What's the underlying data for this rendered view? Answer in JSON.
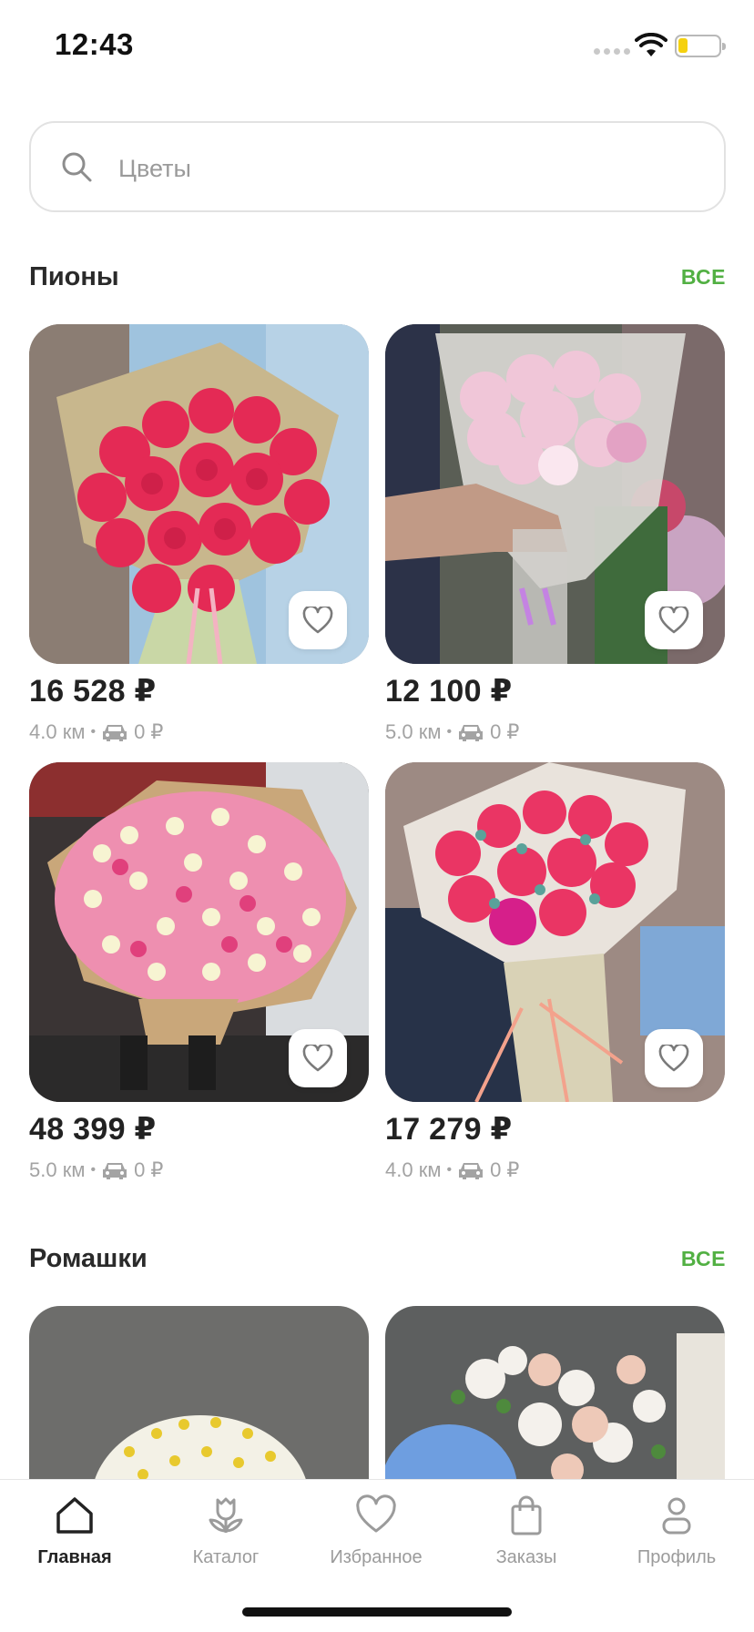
{
  "status_bar": {
    "time": "12:43"
  },
  "search": {
    "placeholder": "Цветы"
  },
  "sections": [
    {
      "title": "Пионы",
      "all_label": "ВСЕ",
      "products": [
        {
          "price": "16 528 ₽",
          "distance": "4.0 км",
          "delivery": "0 ₽"
        },
        {
          "price": "12 100 ₽",
          "distance": "5.0 км",
          "delivery": "0 ₽"
        },
        {
          "price": "48 399 ₽",
          "distance": "5.0 км",
          "delivery": "0 ₽"
        },
        {
          "price": "17 279 ₽",
          "distance": "4.0 км",
          "delivery": "0 ₽"
        }
      ]
    },
    {
      "title": "Ромашки",
      "all_label": "ВСЕ"
    }
  ],
  "tab_bar": {
    "items": [
      {
        "label": "Главная",
        "icon": "home-icon",
        "active": true
      },
      {
        "label": "Каталог",
        "icon": "flower-icon",
        "active": false
      },
      {
        "label": "Избранное",
        "icon": "heart-icon",
        "active": false
      },
      {
        "label": "Заказы",
        "icon": "bag-icon",
        "active": false
      },
      {
        "label": "Профиль",
        "icon": "profile-icon",
        "active": false
      }
    ]
  },
  "colors": {
    "accent": "#52b043",
    "text": "#222222",
    "muted": "#a3a3a3"
  }
}
